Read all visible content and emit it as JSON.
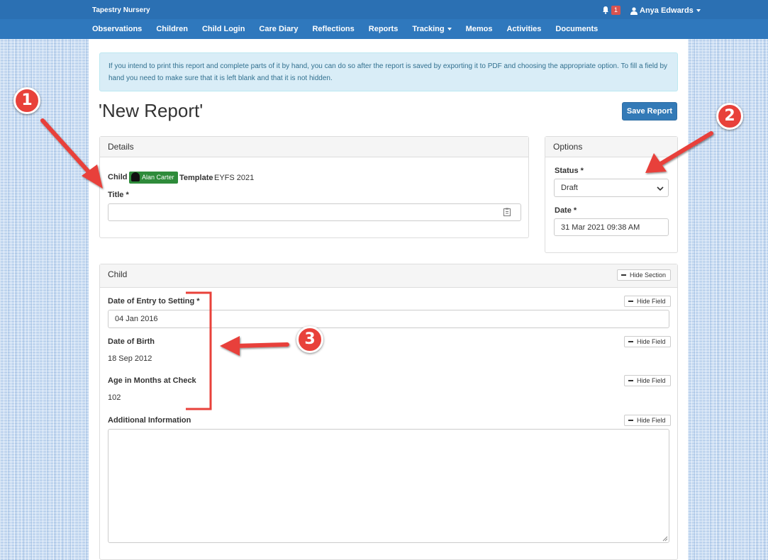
{
  "navbar": {
    "brand": "Tapestry Nursery",
    "notification_count": "1",
    "user_name": "Anya Edwards",
    "links": [
      "Observations",
      "Children",
      "Child Login",
      "Care Diary",
      "Reflections",
      "Reports",
      "Tracking",
      "Memos",
      "Activities",
      "Documents"
    ]
  },
  "alert": {
    "text": "If you intend to print this report and complete parts of it by hand, you can do so after the report is saved by exporting it to PDF and choosing the appropriate option. To fill a field by hand you need to make sure that it is left blank and that it is not hidden."
  },
  "page": {
    "title": "'New Report'",
    "save_label": "Save Report"
  },
  "details": {
    "heading": "Details",
    "child_label": "Child",
    "child_name": "Alan Carter",
    "template_label": "Template",
    "template_value": "EYFS 2021",
    "title_label": "Title *",
    "title_value": ""
  },
  "options": {
    "heading": "Options",
    "status_label": "Status *",
    "status_value": "Draft",
    "date_label": "Date *",
    "date_value": "31 Mar 2021 09:38 AM"
  },
  "child_section": {
    "heading": "Child",
    "hide_section_label": "Hide Section",
    "hide_field_label": "Hide Field",
    "entry_label": "Date of Entry to Setting *",
    "entry_value": "04 Jan 2016",
    "dob_label": "Date of Birth",
    "dob_value": "18 Sep 2012",
    "age_label": "Age in Months at Check",
    "age_value": "102",
    "additional_label": "Additional Information",
    "additional_value": ""
  },
  "annotations": {
    "one": "1",
    "two": "2",
    "three": "3"
  },
  "colors": {
    "navbar": "#2f78bd",
    "primary": "#337ab7",
    "annotation": "#e8413a",
    "child_badge": "#2e8b3a",
    "alert_bg": "#d9edf7"
  }
}
